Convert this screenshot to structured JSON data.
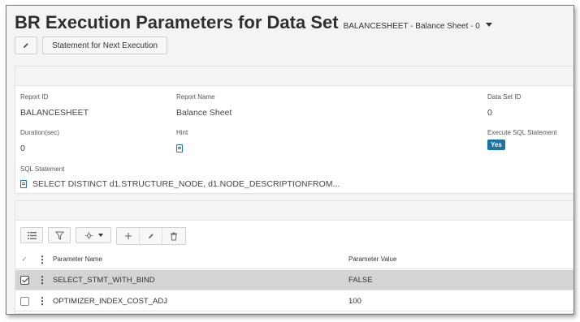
{
  "page": {
    "title": "BR Execution Parameters for Data Set",
    "dataset_selector": "BALANCESHEET - Balance Sheet - 0"
  },
  "toolbar": {
    "edit_icon": "pencil-icon",
    "statement_button": "Statement for Next Execution"
  },
  "details": {
    "report_id_label": "Report ID",
    "report_id_value": "BALANCESHEET",
    "report_name_label": "Report Name",
    "report_name_value": "Balance Sheet",
    "data_set_id_label": "Data Set ID",
    "data_set_id_value": "0",
    "duration_label": "Duration(sec)",
    "duration_value": "0",
    "hint_label": "Hint",
    "hint_icon": "document-icon",
    "execute_sql_label": "Execute SQL Statement",
    "execute_sql_value": "Yes",
    "sql_label": "SQL Statement",
    "sql_value": "SELECT DISTINCT d1.STRUCTURE_NODE, d1.NODE_DESCRIPTIONFROM..."
  },
  "grid": {
    "toolbar_icons": [
      "list-icon",
      "filter-icon",
      "settings-dropdown-icon",
      "add-icon",
      "edit-icon",
      "delete-icon"
    ],
    "columns": {
      "check": "✓",
      "menu": "⋮",
      "name": "Parameter Name",
      "value": "Parameter Value"
    },
    "rows": [
      {
        "name": "SELECT_STMT_WITH_BIND",
        "value": "FALSE",
        "selected": true
      },
      {
        "name": "OPTIMIZER_INDEX_COST_ADJ",
        "value": "100",
        "selected": false
      }
    ]
  },
  "colors": {
    "accent": "#1a74a8",
    "selected_row": "#d4d4d4"
  }
}
